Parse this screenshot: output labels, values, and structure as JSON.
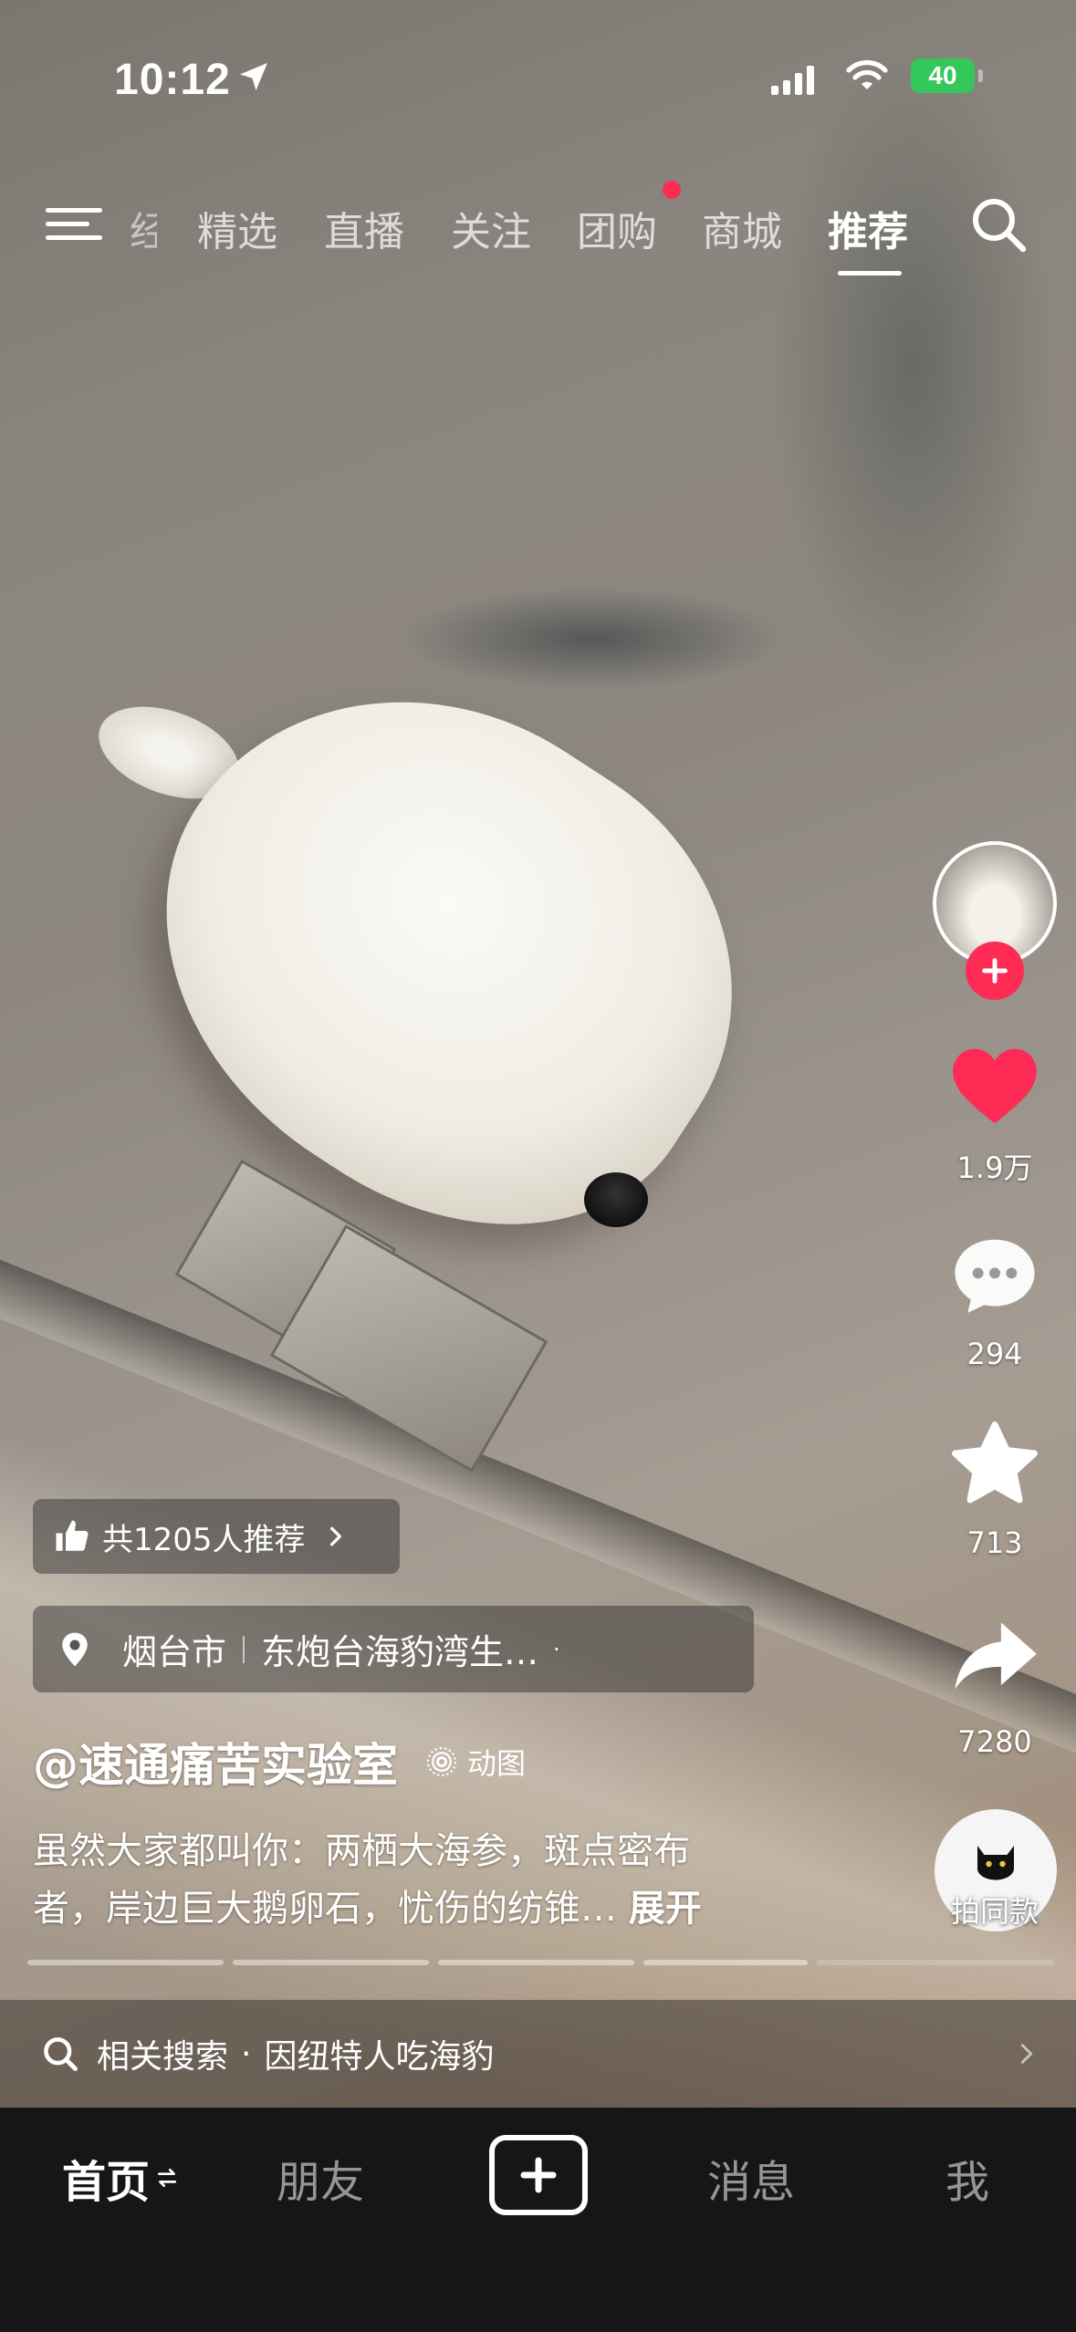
{
  "status_bar": {
    "time": "10:12",
    "battery": "40"
  },
  "top_nav": {
    "partial_tab": "经验",
    "tabs": [
      {
        "label": "精选"
      },
      {
        "label": "直播"
      },
      {
        "label": "关注"
      },
      {
        "label": "团购"
      },
      {
        "label": "商城"
      },
      {
        "label": "推荐"
      }
    ],
    "active_tab": "推荐"
  },
  "right_rail": {
    "likes": "1.9万",
    "comments": "294",
    "favorites": "713",
    "shares": "7280",
    "same_style_label": "拍同款"
  },
  "video_info": {
    "recommend_text": "共1205人推荐",
    "location_city": "烟台市",
    "location_place": "东炮台海豹湾生…",
    "username": "@速通痛苦实验室",
    "gif_tag": "动图",
    "caption_line1": "虽然大家都叫你：两栖大海参，斑点密布",
    "caption_line2": "者，岸边巨大鹅卵石，忧伤的纺锥…",
    "expand_label": "展开"
  },
  "related_search": {
    "label": "相关搜索",
    "separator": "·",
    "query": "因纽特人吃海豹"
  },
  "bottom_nav": {
    "home": "首页",
    "friends": "朋友",
    "messages": "消息",
    "me": "我"
  },
  "colors": {
    "accent_red": "#fe2c55",
    "battery_green": "#34c759"
  },
  "icons": [
    "location-arrow-icon",
    "signal-icon",
    "wifi-icon",
    "menu-icon",
    "search-icon",
    "heart-icon",
    "comment-icon",
    "star-icon",
    "share-icon",
    "thumb-up-icon",
    "location-pin-icon",
    "chevron-right-icon",
    "live-photo-icon",
    "plus-icon",
    "swap-icon"
  ]
}
